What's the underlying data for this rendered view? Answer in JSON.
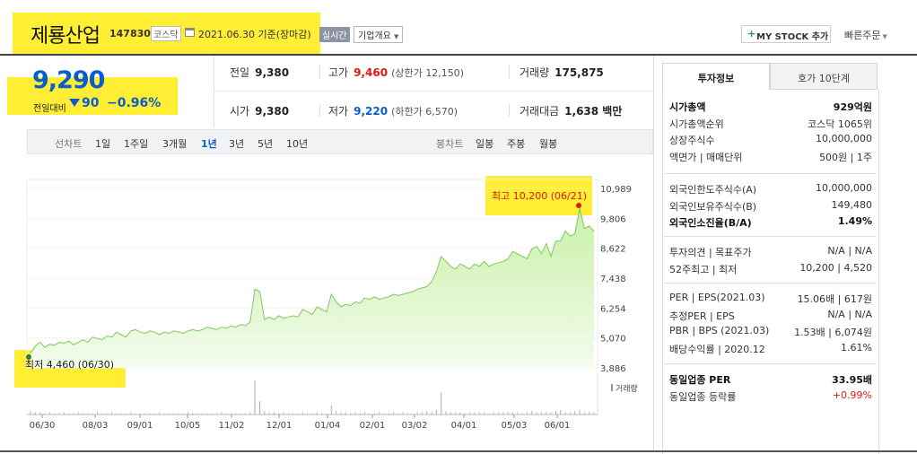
{
  "header": {
    "company_name": "제룡산업",
    "code": "147830",
    "market": "코스닥",
    "date_text": "2021.06.30 기준(장마감)",
    "realtime_label": "실시간",
    "overview_label": "기업개요",
    "mystock_label": "MY STOCK 추가",
    "quick_order_label": "빠른주문"
  },
  "price_block": {
    "price": "9,290",
    "vs_label": "전일대비",
    "change": "90",
    "change_pct": "−0.96%"
  },
  "stats": {
    "prev_close_label": "전일",
    "prev_close": "9,380",
    "high_label": "고가",
    "high": "9,460",
    "upper_limit": "(상한가 12,150)",
    "volume_label": "거래량",
    "volume": "175,875",
    "open_label": "시가",
    "open": "9,380",
    "low_label": "저가",
    "low": "9,220",
    "lower_limit": "(하한가 6,570)",
    "amount_label": "거래대금",
    "amount": "1,638 백만"
  },
  "toolbar": {
    "line_label": "선차트",
    "line_periods": [
      "1일",
      "1주일",
      "3개월",
      "1년",
      "3년",
      "5년",
      "10년"
    ],
    "active_period": "1년",
    "candle_label": "봉차트",
    "candle_periods": [
      "일봉",
      "주봉",
      "월봉"
    ]
  },
  "chart_data": {
    "type": "area",
    "y_ticks": [
      10989,
      9806,
      8622,
      7438,
      6254,
      5070,
      3886
    ],
    "y_tick_labels": [
      "10,989",
      "9,806",
      "8,622",
      "7,438",
      "6,254",
      "5,070",
      "3,886"
    ],
    "ylim": [
      3886,
      10989
    ],
    "x_tick_labels": [
      "06/30",
      "08/03",
      "09/01",
      "10/05",
      "11/02",
      "12/01",
      "01/04",
      "02/01",
      "03/02",
      "04/01",
      "05/03",
      "06/01"
    ],
    "high_annotation": "최고 10,200 (06/21)",
    "low_annotation": "최저 4,460 (06/30)",
    "volume_label": "거래량",
    "series": [
      {
        "values": [
          4460,
          4750,
          4900,
          4700,
          4820,
          4780,
          4900,
          4860,
          4950,
          4800,
          4900,
          5000,
          4900,
          5100,
          5050,
          5000,
          5150,
          5100,
          5300,
          5200,
          5100,
          5350,
          5400,
          5300,
          5250,
          5350,
          5300,
          5200,
          5300,
          5250,
          5350,
          5300,
          5250,
          5350,
          5400,
          5350,
          5400,
          5500,
          5450,
          5400,
          5500,
          5450,
          5550,
          5500,
          5600,
          5550,
          5700,
          7000,
          6900,
          5800,
          5900,
          5800,
          5950,
          5850,
          5900,
          5950,
          5900,
          6200,
          6100,
          6000,
          6300,
          6200,
          6100,
          6800,
          6500,
          6300,
          6400,
          6350,
          6500,
          6450,
          6650,
          6600,
          6700,
          6600,
          6650,
          6700,
          6800,
          6750,
          6800,
          6850,
          6900,
          7000,
          7050,
          7100,
          7300,
          7700,
          8300,
          8100,
          7900,
          7800,
          8000,
          7900,
          7800,
          8000,
          7900,
          8100,
          7900,
          8000,
          8050,
          8100,
          8200,
          8500,
          8400,
          8300,
          8200,
          8600,
          8700,
          8400,
          8800,
          8300,
          8900,
          8900,
          9300,
          9100,
          9200,
          10200,
          9400,
          9500,
          9300
        ]
      }
    ],
    "volume": [
      3,
      2,
      2,
      1,
      2,
      1,
      1,
      2,
      1,
      1,
      2,
      1,
      1,
      1,
      2,
      1,
      1,
      2,
      1,
      1,
      1,
      2,
      1,
      1,
      1,
      1,
      1,
      2,
      1,
      1,
      1,
      1,
      1,
      2,
      1,
      1,
      1,
      1,
      1,
      1,
      2,
      1,
      1,
      1,
      1,
      1,
      2,
      30,
      12,
      3,
      2,
      2,
      1,
      2,
      1,
      1,
      1,
      2,
      1,
      1,
      2,
      1,
      1,
      8,
      3,
      2,
      2,
      1,
      2,
      1,
      2,
      1,
      1,
      2,
      1,
      1,
      2,
      1,
      2,
      1,
      1,
      2,
      2,
      3,
      2,
      4,
      20,
      3,
      2,
      2,
      2,
      1,
      2,
      2,
      2,
      2,
      1,
      2,
      2,
      2,
      2,
      2,
      2,
      1,
      2,
      3,
      2,
      2,
      2,
      2,
      3,
      4,
      2,
      2,
      3,
      4,
      2,
      2,
      2
    ]
  },
  "right_panel": {
    "tab_info": "투자정보",
    "tab_order": "호가 10단계",
    "rows1": [
      {
        "l": "시가총액",
        "r": "929억원",
        "bold": true
      },
      {
        "l": "시가총액순위",
        "r": "코스닥 1065위"
      },
      {
        "l": "상장주식수",
        "r": "10,000,000"
      },
      {
        "l": "액면가 | 매매단위",
        "r": "500원 | 1주"
      }
    ],
    "rows2": [
      {
        "l": "외국인한도주식수(A)",
        "r": "10,000,000"
      },
      {
        "l": "외국인보유주식수(B)",
        "r": "149,480"
      },
      {
        "l": "외국인소진율(B/A)",
        "r": "1.49%",
        "bold": true
      }
    ],
    "rows3": [
      {
        "l": "투자의견 | 목표주가",
        "r": "N/A | N/A"
      },
      {
        "l": "52주최고 | 최저",
        "r": "10,200 | 4,520"
      }
    ],
    "rows4": [
      {
        "l": "PER | EPS(2021.03)",
        "r": "15.06배 | 617원"
      },
      {
        "l": "추정PER | EPS",
        "r": "N/A | N/A"
      },
      {
        "l": "PBR | BPS (2021.03)",
        "r": "1.53배 | 6,074원"
      },
      {
        "l": "배당수익률 | 2020.12",
        "r": "1.61%"
      }
    ],
    "rows5": [
      {
        "l": "동일업종 PER",
        "r": "33.95배",
        "bold": true
      },
      {
        "l": "동일업종 등락률",
        "r": "+0.99%",
        "red": true
      }
    ]
  },
  "colors": {
    "price_blue": "#0a5ecb",
    "rise_red": "#e31414",
    "area_fill": "#c8f0a8",
    "area_line": "#7cc95a",
    "highlight": "#ffee33"
  }
}
